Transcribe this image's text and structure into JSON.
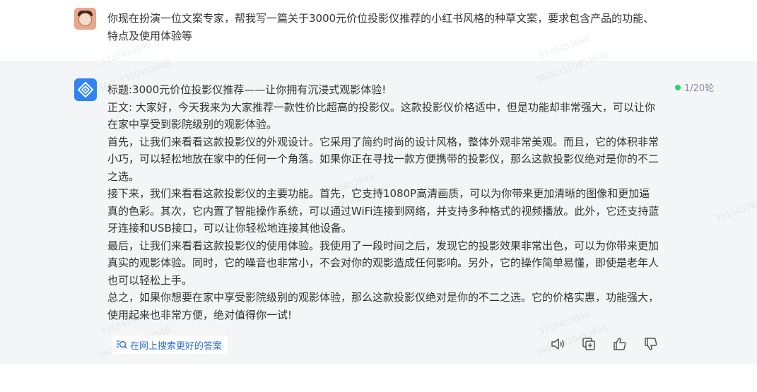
{
  "user_message": {
    "text": "你现在扮演一位文案专家，帮我写一篇关于3000元价位投影仪推荐的小红书风格的种草文案，要求包含产品的功能、特点及使用体验等"
  },
  "assistant_message": {
    "paragraphs": [
      "标题:3000元价位投影仪推荐——让你拥有沉浸式观影体验!",
      "正文: 大家好，今天我来为大家推荐一款性价比超高的投影仪。这款投影仪价格适中，但是功能却非常强大，可以让你在家中享受到影院级别的观影体验。",
      "首先，让我们来看看这款投影仪的外观设计。它采用了简约时尚的设计风格，整体外观非常美观。而且，它的体积非常小巧，可以轻松地放在家中的任何一个角落。如果你正在寻找一款方便携带的投影仪，那么这款投影仪绝对是你的不二之选。",
      "接下来，我们来看看这款投影仪的主要功能。首先，它支持1080P高清画质，可以为你带来更加清晰的图像和更加逼真的色彩。其次，它内置了智能操作系统，可以通过WiFi连接到网络，并支持多种格式的视频播放。此外，它还支持蓝牙连接和USB接口，可以让你轻松地连接其他设备。",
      "最后，让我们来看看这款投影仪的使用体验。我使用了一段时间之后，发现它的投影效果非常出色，可以为你带来更加真实的观影体验。同时，它的噪音也非常小，不会对你的观影造成任何影响。另外，它的操作简单易懂，即使是老年人也可以轻松上手。",
      "总之，如果你想要在家中享受影院级别的观影体验，那么这款投影仪绝对是你的不二之选。它的价格实惠，功能强大，使用起来也非常方便，绝对值得你一试!"
    ],
    "round_status": "1/20轮",
    "status_color": "#2bd36b",
    "search_better_label": "在网上搜索更好的答案",
    "actions": [
      "speaker-icon",
      "copy-icon",
      "thumbs-up-icon",
      "thumbs-down-icon"
    ]
  },
  "watermarks": [
    "3310453848",
    "360U3310453848",
    "3310453848",
    "360U3310453848",
    "3310453848",
    "360U3310453848",
    "3310453848",
    "360U3310453848",
    "3310453848",
    "360U3310453848",
    "3310453848"
  ],
  "colors": {
    "ai_background": "#f4f5f7",
    "ai_avatar": "#2f84f0",
    "link": "#2c6fd6"
  }
}
